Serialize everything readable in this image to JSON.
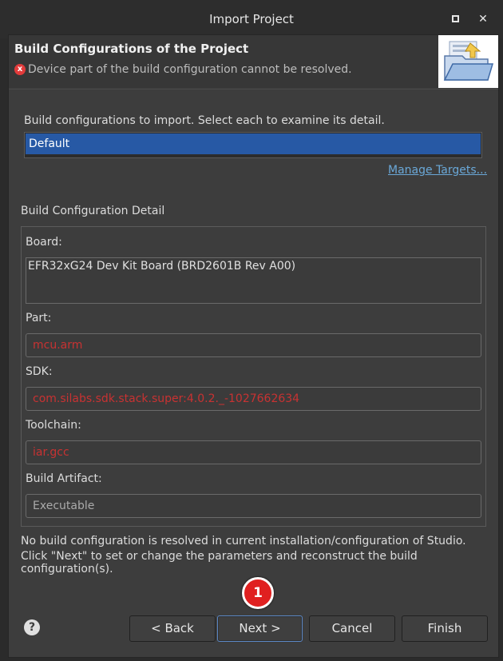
{
  "window": {
    "title": "Import Project",
    "maximize_icon": "maximize-icon",
    "close_icon": "close-icon",
    "close_glyph": "✕"
  },
  "header": {
    "title": "Build Configurations of the Project",
    "error_message": "Device part of the build configuration cannot be resolved.",
    "error_icon": "error-icon",
    "error_glyph": "x",
    "wizard_image": "import-folder-icon"
  },
  "configs": {
    "label": "Build configurations to import. Select each to examine its detail.",
    "items": [
      "Default"
    ],
    "selected": "Default",
    "manage_link": "Manage Targets..."
  },
  "detail": {
    "group_label": "Build Configuration Detail",
    "board_label": "Board:",
    "board_value": "EFR32xG24 Dev Kit Board (BRD2601B Rev A00)",
    "part_label": "Part:",
    "part_value": "mcu.arm",
    "sdk_label": "SDK:",
    "sdk_value": "com.silabs.sdk.stack.super:4.0.2._-1027662634",
    "toolchain_label": "Toolchain:",
    "toolchain_value": "iar.gcc",
    "artifact_label": "Build Artifact:",
    "artifact_value": "Executable"
  },
  "messages": {
    "line1": "No build configuration is resolved in current installation/configuration of Studio.",
    "line2": "Click \"Next\" to set or change the parameters and reconstruct the build configuration(s)."
  },
  "badge": {
    "number": "1"
  },
  "buttons": {
    "help_glyph": "?",
    "back": "< Back",
    "next": "Next >",
    "cancel": "Cancel",
    "finish": "Finish"
  },
  "colors": {
    "selection": "#2759a5",
    "error_text": "#c83232",
    "link": "#6aa8d8",
    "badge": "#e02020"
  }
}
